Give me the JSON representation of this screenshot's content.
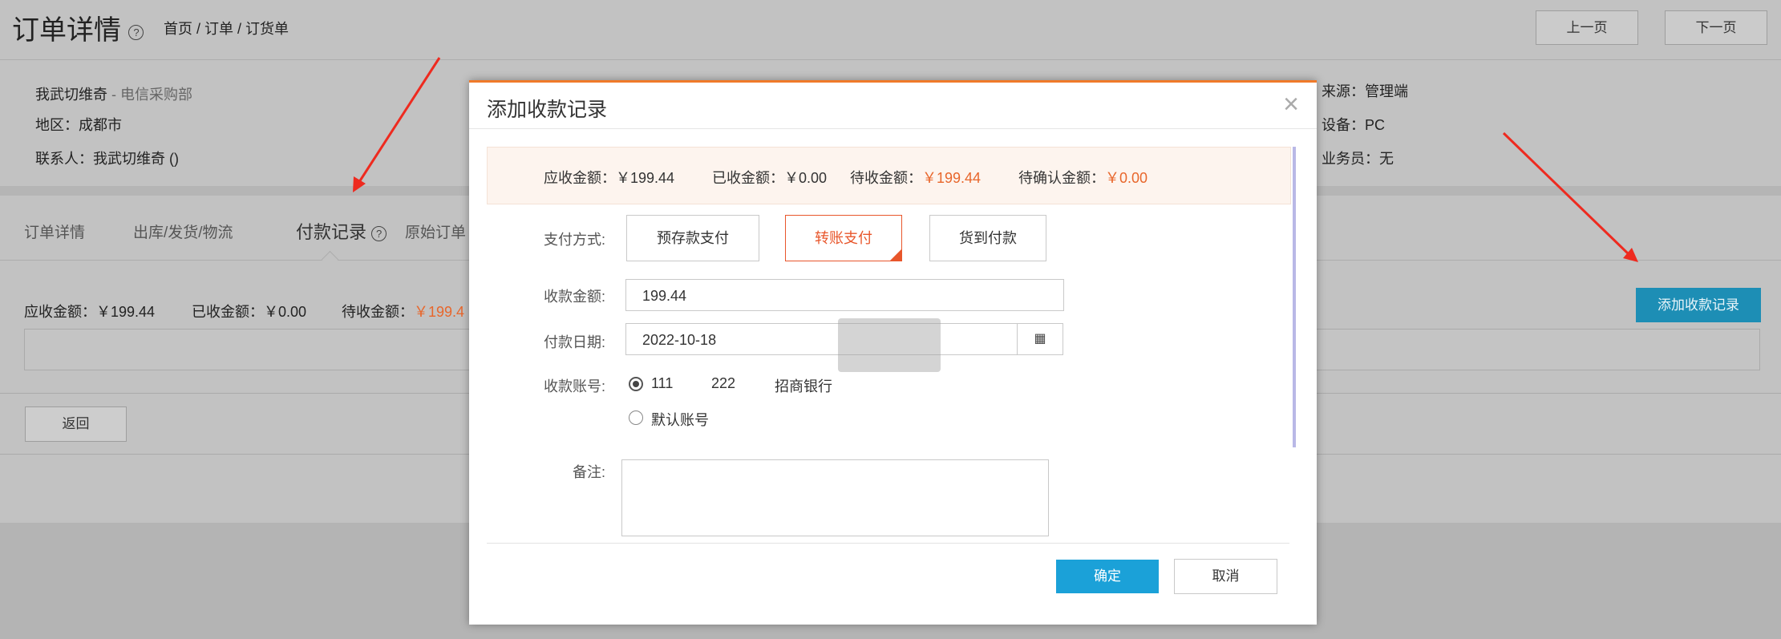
{
  "page": {
    "title": "订单详情",
    "breadcrumb": "首页 / 订单 / 订货单",
    "prev_label": "上一页",
    "next_label": "下一页",
    "customer_name": "我武切维奇",
    "customer_dept": " - 电信采购部",
    "region": "地区：成都市",
    "contact": "联系人：我武切维奇  ()",
    "source": "来源：管理端",
    "device": "设备：PC",
    "salesperson": "业务员：无",
    "tabs": [
      "订单详情",
      "出库/发货/物流",
      "付款记录",
      "原始订单"
    ],
    "summary": {
      "receivable": "应收金额：￥199.44",
      "received": "已收金额：￥0.00",
      "pending_label": "待收金额：",
      "pending_value": "￥199.4"
    },
    "add_button": "添加收款记录",
    "back_button": "返回"
  },
  "modal": {
    "title": "添加收款记录",
    "close": "×",
    "summary": {
      "receivable": "应收金额：￥199.44",
      "received": "已收金额：￥0.00",
      "pending_label": "待收金额：",
      "pending_value": "￥199.44",
      "confirm_label": "待确认金额：",
      "confirm_value": "￥0.00"
    },
    "pay_method_label": "支付方式:",
    "pay_methods": [
      "预存款支付",
      "转账支付",
      "货到付款"
    ],
    "amount_label": "收款金额:",
    "amount_value": "199.44",
    "date_label": "付款日期:",
    "date_value": "2022-10-18",
    "account_label": "收款账号:",
    "account_option1": [
      "111",
      "222",
      "招商银行"
    ],
    "account_option2": "默认账号",
    "note_label": "备注:",
    "ok_label": "确定",
    "cancel_label": "取消"
  },
  "colors": {
    "accent_orange": "#e8662b",
    "primary_blue": "#1ba1d8",
    "add_button_blue": "#1d8eb5",
    "modal_top_border": "#f07a2a"
  }
}
